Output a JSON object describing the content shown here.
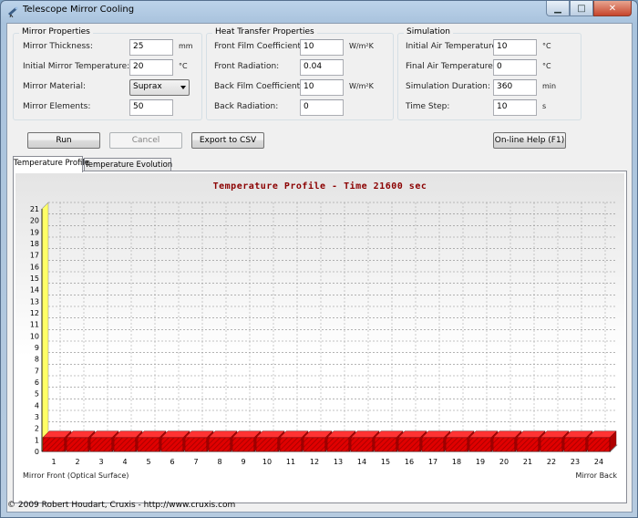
{
  "window": {
    "title": "Telescope Mirror Cooling",
    "controls": [
      "minimize",
      "maximize",
      "close"
    ]
  },
  "mirror_properties": {
    "title": "Mirror Properties",
    "thickness": {
      "label": "Mirror Thickness:",
      "value": "25",
      "unit": "mm"
    },
    "initial_temp": {
      "label": "Initial Mirror Temperature:",
      "value": "20",
      "unit": "°C"
    },
    "material": {
      "label": "Mirror Material:",
      "value": "Suprax"
    },
    "elements": {
      "label": "Mirror Elements:",
      "value": "50"
    }
  },
  "heat_transfer": {
    "title": "Heat Transfer Properties",
    "front_film": {
      "label": "Front Film Coefficient:",
      "value": "10",
      "unit": "W/m²K"
    },
    "front_radiation": {
      "label": "Front Radiation:",
      "value": "0.04"
    },
    "back_film": {
      "label": "Back Film Coefficient:",
      "value": "10",
      "unit": "W/m²K"
    },
    "back_radiation": {
      "label": "Back Radiation:",
      "value": "0"
    }
  },
  "simulation": {
    "title": "Simulation",
    "initial_air": {
      "label": "Initial Air Temperature:",
      "value": "10",
      "unit": "°C"
    },
    "final_air": {
      "label": "Final Air Temperature:",
      "value": "0",
      "unit": "°C"
    },
    "duration": {
      "label": "Simulation Duration:",
      "value": "360",
      "unit": "min"
    },
    "time_step": {
      "label": "Time Step:",
      "value": "10",
      "unit": "s"
    }
  },
  "buttons": {
    "run": "Run",
    "cancel": "Cancel",
    "export": "Export to CSV",
    "help": "On-line Help (F1)"
  },
  "tabs": [
    {
      "label": "Temperature Profile"
    },
    {
      "label": "Temperature Evolution"
    }
  ],
  "chart_data": {
    "type": "bar",
    "title": "Temperature Profile - Time 21600 sec",
    "x_ticks": [
      "1",
      "2",
      "3",
      "4",
      "5",
      "6",
      "7",
      "8",
      "9",
      "10",
      "11",
      "12",
      "13",
      "14",
      "15",
      "16",
      "17",
      "18",
      "19",
      "20",
      "21",
      "22",
      "23",
      "24"
    ],
    "x_left_label": "Mirror Front (Optical Surface)",
    "x_right_label": "Mirror Back",
    "y_ticks": [
      "0",
      "1",
      "2",
      "3",
      "4",
      "5",
      "6",
      "7",
      "8",
      "9",
      "10",
      "11",
      "12",
      "13",
      "14",
      "15",
      "16",
      "17",
      "18",
      "19",
      "20",
      "21"
    ],
    "ylim": [
      0,
      21
    ],
    "values": [
      1.2,
      1.2,
      1.2,
      1.2,
      1.2,
      1.2,
      1.2,
      1.2,
      1.2,
      1.2,
      1.2,
      1.2,
      1.2,
      1.2,
      1.2,
      1.2,
      1.2,
      1.2,
      1.2,
      1.2,
      1.2,
      1.2,
      1.2,
      1.2
    ],
    "series_color": "#e00000",
    "grid": true
  },
  "status": {
    "text": "© 2009 Robert Houdart, Cruxis  -  http://www.cruxis.com"
  }
}
